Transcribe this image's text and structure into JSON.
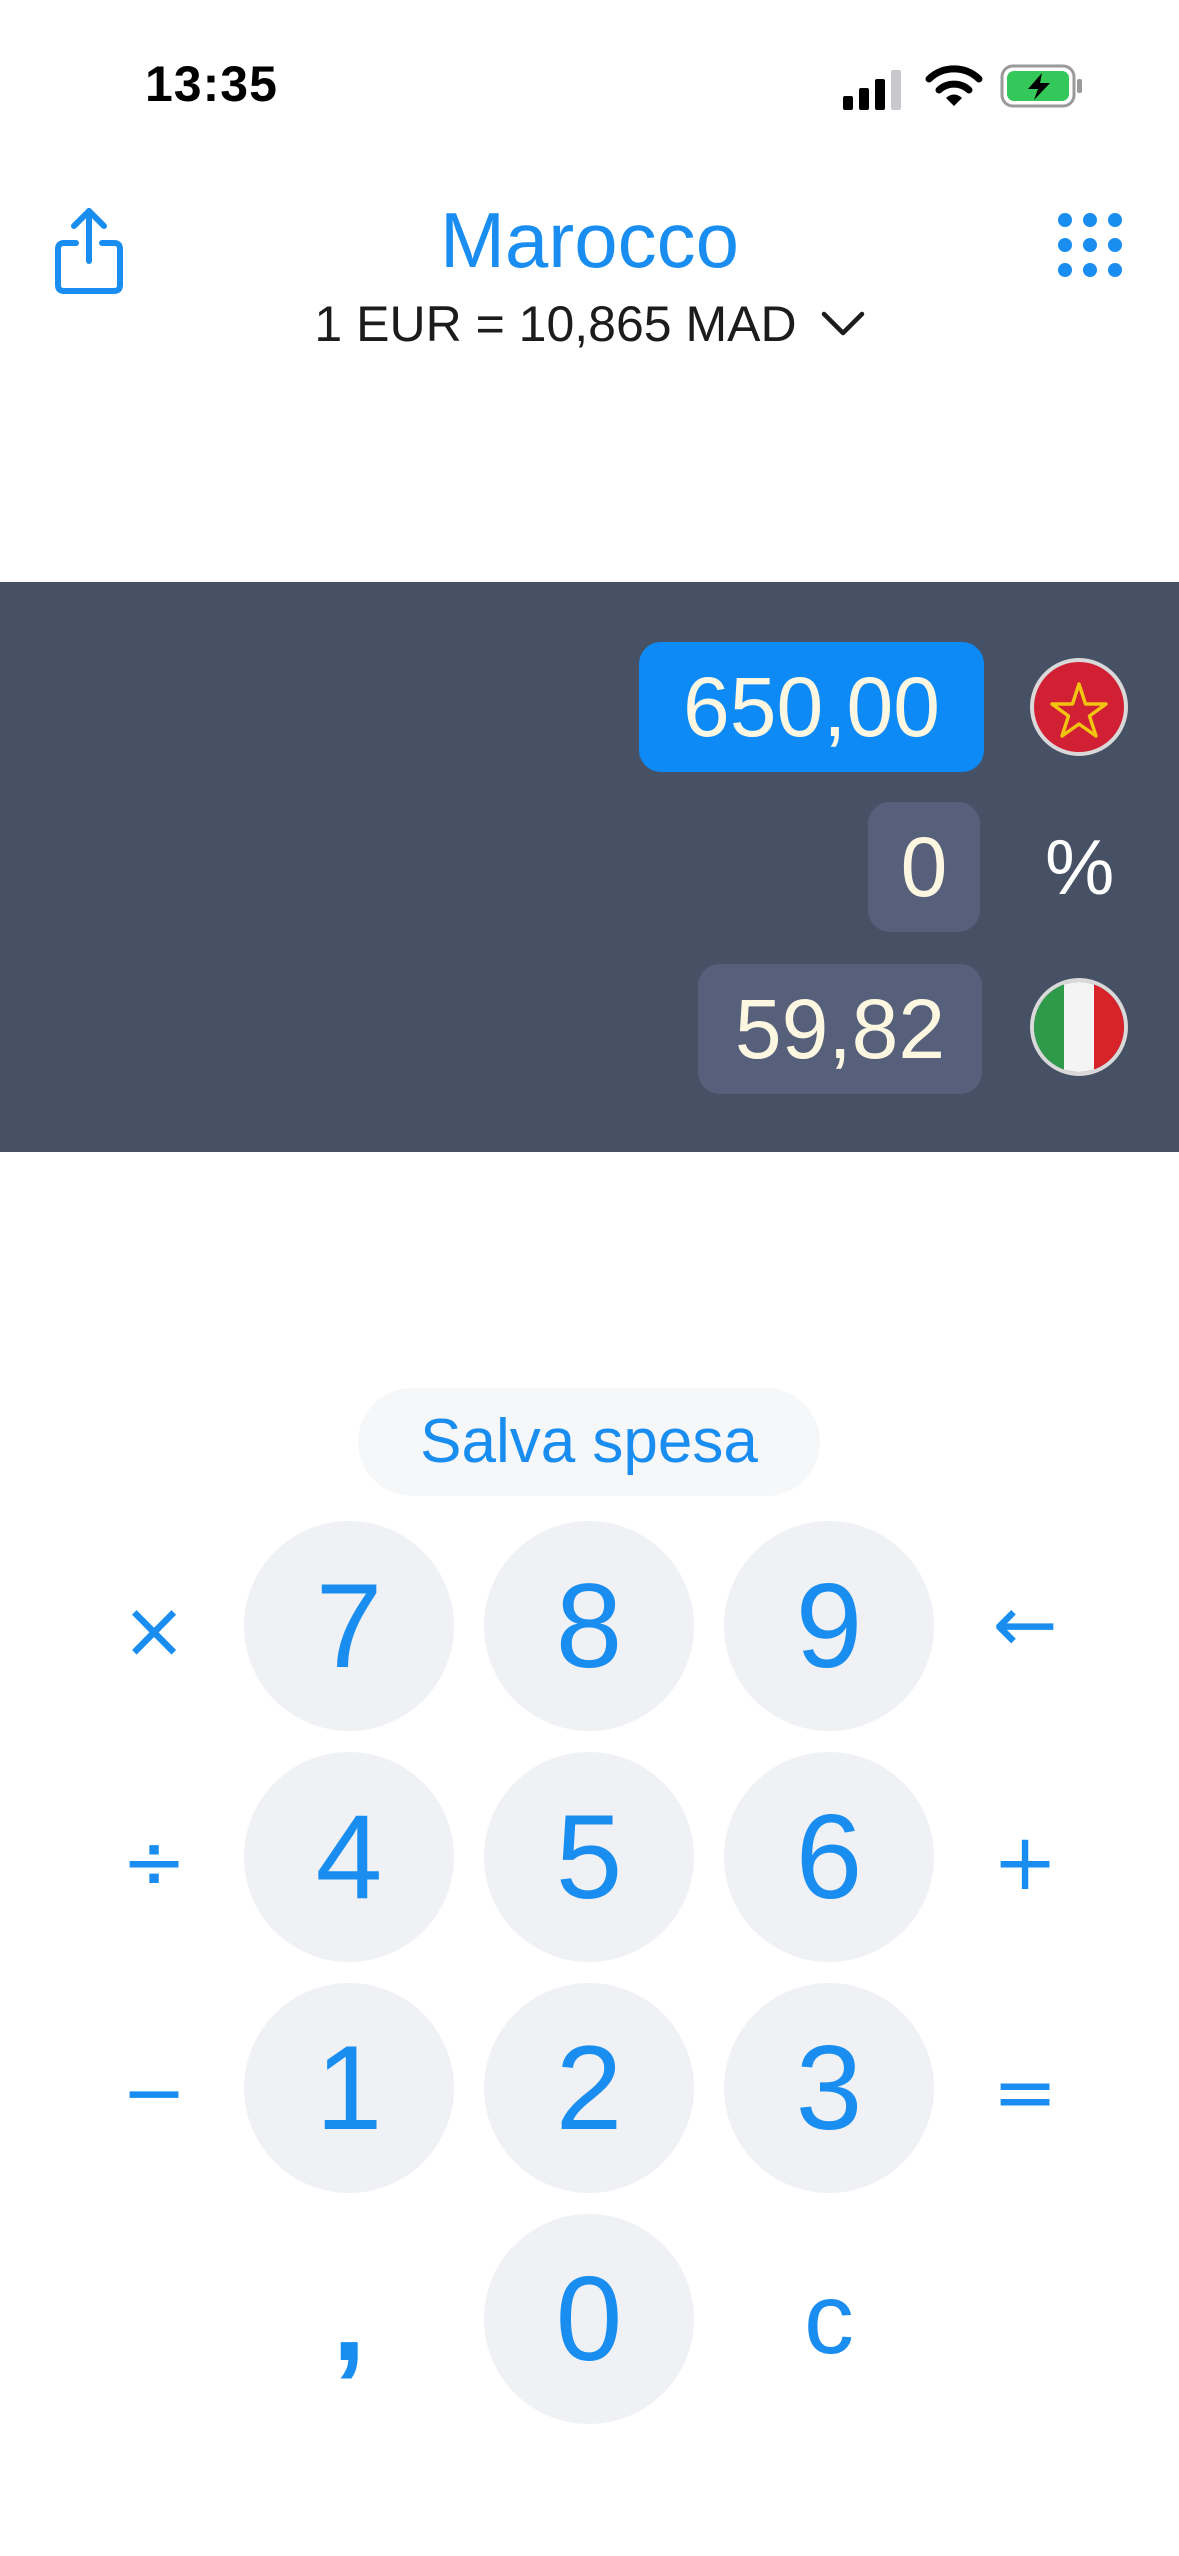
{
  "status_bar": {
    "time": "13:35"
  },
  "header": {
    "title": "Marocco",
    "rate": "1 EUR = 10,865 MAD",
    "icons": [
      "share-icon",
      "chevron-down-icon",
      "grid-icon"
    ]
  },
  "display": {
    "foreign_amount": "650,00",
    "percent_value": "0",
    "percent_sign": "%",
    "home_amount": "59,82",
    "foreign_flag": "morocco-flag",
    "home_flag": "italy-flag"
  },
  "save_button": "Salva spesa",
  "keypad": {
    "multiply": "×",
    "divide": "÷",
    "minus": "−",
    "backspace": "←",
    "plus": "+",
    "equals": "=",
    "k7": "7",
    "k8": "8",
    "k9": "9",
    "k4": "4",
    "k5": "5",
    "k6": "6",
    "k1": "1",
    "k2": "2",
    "k3": "3",
    "comma": ",",
    "k0": "0",
    "clear": "c"
  },
  "colors": {
    "accent": "#1a8ef0",
    "panel": "#465165",
    "pill": "#56607a",
    "active_pill": "#0d8af6",
    "key_bg": "#f0f1f5"
  }
}
